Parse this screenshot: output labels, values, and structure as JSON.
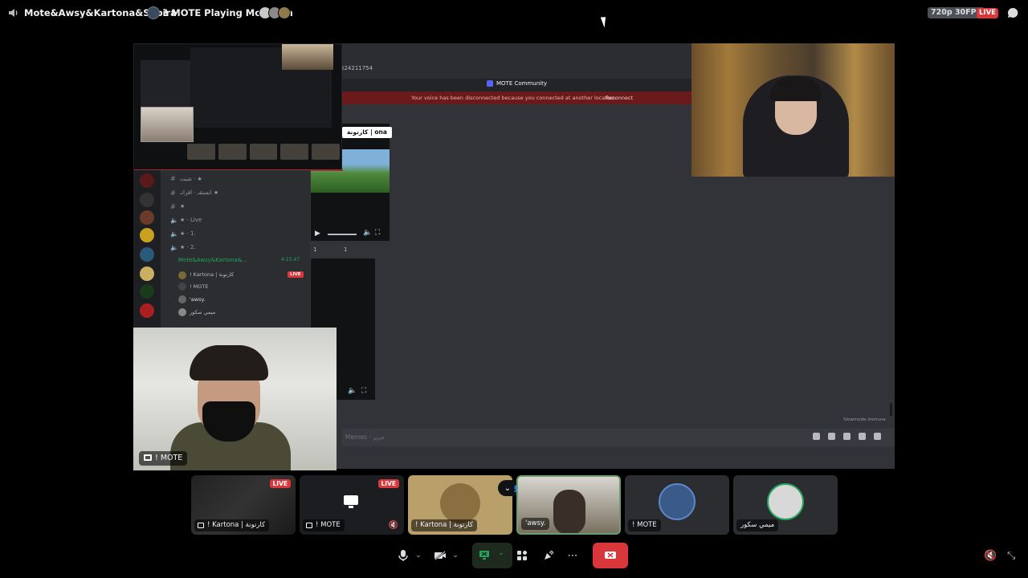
{
  "topbar": {
    "channel_name": "Mote&Awsy&Kartona&Sabira",
    "status": "! MOTE Playing Modrinth",
    "quality": "720p 30FPS",
    "live_badge": "LIVE",
    "icons": [
      "speaker-icon",
      "chat-icon"
    ]
  },
  "stage": {
    "server_id_fragment": "524211754",
    "community_name": "MOTE Community",
    "notice_text": "Your voice has been disconnected because you connected at another location.",
    "notice_link": "Reconnect",
    "channel_label": "كارتونة | ona",
    "channels": [
      {
        "name": "شيت ·  ★",
        "type": "text"
      },
      {
        "name": "انستقـ · اقرانـ  ★",
        "type": "text"
      },
      {
        "name": "★",
        "type": "text"
      },
      {
        "name": "★ · Live",
        "type": "voice"
      },
      {
        "name": "★ · 1.",
        "type": "voice"
      },
      {
        "name": "★ · 2.",
        "type": "voice"
      }
    ],
    "voice_channel": {
      "name": "Mote&Awsy&Kartona&...",
      "timer": "4:15:47",
      "users": [
        {
          "name": "! Kartona | كارتونة",
          "live": "LIVE"
        },
        {
          "name": "! MOTE",
          "badge": "MOTE"
        },
        {
          "name": "'awsy."
        },
        {
          "name": "ميمي سكور"
        }
      ]
    },
    "reactions": [
      "1",
      "1"
    ],
    "input_placeholder": "Memes · جرير",
    "slowmode": "Slowmode immune"
  },
  "cam_left": {
    "label": "! MOTE"
  },
  "tiles": [
    {
      "label": "! Kartona | كارتونة",
      "live": "LIVE",
      "type": "screen"
    },
    {
      "label": "! MOTE",
      "live": "LIVE",
      "type": "screen"
    },
    {
      "label": "! Kartona | كارتونة",
      "type": "avatar"
    },
    {
      "label": "'awsy.",
      "type": "camera"
    },
    {
      "label": "! MOTE",
      "type": "avatar"
    },
    {
      "label": "ميمي سكور",
      "type": "avatar"
    }
  ],
  "controls": [
    {
      "name": "microphone-button",
      "icon": "mic-icon"
    },
    {
      "name": "camera-button",
      "icon": "video-off-icon"
    },
    {
      "name": "screen-share-button",
      "icon": "screen-share-icon"
    },
    {
      "name": "activities-button",
      "icon": "activities-icon"
    },
    {
      "name": "soundboard-button",
      "icon": "soundboard-icon"
    },
    {
      "name": "more-button",
      "icon": "ellipsis-icon"
    },
    {
      "name": "disconnect-button",
      "icon": "disconnect-icon"
    }
  ],
  "colors": {
    "live": "#da373c",
    "accent_green": "#23a55a",
    "background": "#000000"
  }
}
